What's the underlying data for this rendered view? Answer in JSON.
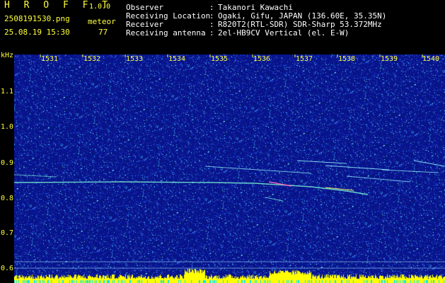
{
  "header": {
    "app_logo": "H R O F F T",
    "version": "1.0.0",
    "filename": "2508191530.png",
    "datetime": "25.08.19 15:30",
    "count_label": "meteor",
    "count_value": "77",
    "info": [
      {
        "label": "Observer",
        "sep": ":",
        "value": "Takanori Kawachi"
      },
      {
        "label": "Receiving Location",
        "sep": ":",
        "value": "Ogaki, Gifu, JAPAN (136.60E, 35.35N)"
      },
      {
        "label": "Receiver",
        "sep": ":",
        "value": "R820T2(RTL-SDR) SDR-Sharp 53.372MHz"
      },
      {
        "label": "Receiving antenna",
        "sep": ":",
        "value": "2el-HB9CV Vertical (el. E-W)"
      }
    ]
  },
  "spectrogram": {
    "y_unit": "kHz",
    "y_ticks": [
      "1.1",
      "1.0",
      "0.9",
      "0.8",
      "0.7",
      "0.6"
    ],
    "x_ticks": [
      "1531",
      "1532",
      "1533",
      "1534",
      "1535",
      "1536",
      "1537",
      "1538",
      "1539",
      "1540"
    ],
    "colors": {
      "background": "#0a1a8c",
      "label": "#ffff3c",
      "noise_bar": "#ffff00",
      "noise_cyan": "#00e5ff"
    }
  }
}
